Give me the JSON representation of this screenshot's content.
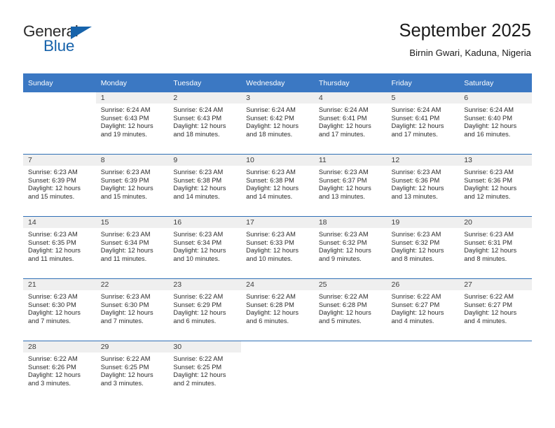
{
  "brand": {
    "name_part1": "General",
    "name_part2": "Blue",
    "accent_color": "#1763ab"
  },
  "header": {
    "title": "September 2025",
    "subtitle": "Birnin Gwari, Kaduna, Nigeria"
  },
  "theme": {
    "header_row_color": "#3b78c3",
    "week_divider_color": "#2f6fb5",
    "daynum_band_color": "#efefef"
  },
  "calendar": {
    "weekday_headers": [
      "Sunday",
      "Monday",
      "Tuesday",
      "Wednesday",
      "Thursday",
      "Friday",
      "Saturday"
    ],
    "weeks": [
      [
        {
          "day": "",
          "blank": true
        },
        {
          "day": "1",
          "sunrise": "Sunrise: 6:24 AM",
          "sunset": "Sunset: 6:43 PM",
          "daylight_line1": "Daylight: 12 hours",
          "daylight_line2": "and 19 minutes."
        },
        {
          "day": "2",
          "sunrise": "Sunrise: 6:24 AM",
          "sunset": "Sunset: 6:43 PM",
          "daylight_line1": "Daylight: 12 hours",
          "daylight_line2": "and 18 minutes."
        },
        {
          "day": "3",
          "sunrise": "Sunrise: 6:24 AM",
          "sunset": "Sunset: 6:42 PM",
          "daylight_line1": "Daylight: 12 hours",
          "daylight_line2": "and 18 minutes."
        },
        {
          "day": "4",
          "sunrise": "Sunrise: 6:24 AM",
          "sunset": "Sunset: 6:41 PM",
          "daylight_line1": "Daylight: 12 hours",
          "daylight_line2": "and 17 minutes."
        },
        {
          "day": "5",
          "sunrise": "Sunrise: 6:24 AM",
          "sunset": "Sunset: 6:41 PM",
          "daylight_line1": "Daylight: 12 hours",
          "daylight_line2": "and 17 minutes."
        },
        {
          "day": "6",
          "sunrise": "Sunrise: 6:24 AM",
          "sunset": "Sunset: 6:40 PM",
          "daylight_line1": "Daylight: 12 hours",
          "daylight_line2": "and 16 minutes."
        }
      ],
      [
        {
          "day": "7",
          "sunrise": "Sunrise: 6:23 AM",
          "sunset": "Sunset: 6:39 PM",
          "daylight_line1": "Daylight: 12 hours",
          "daylight_line2": "and 15 minutes."
        },
        {
          "day": "8",
          "sunrise": "Sunrise: 6:23 AM",
          "sunset": "Sunset: 6:39 PM",
          "daylight_line1": "Daylight: 12 hours",
          "daylight_line2": "and 15 minutes."
        },
        {
          "day": "9",
          "sunrise": "Sunrise: 6:23 AM",
          "sunset": "Sunset: 6:38 PM",
          "daylight_line1": "Daylight: 12 hours",
          "daylight_line2": "and 14 minutes."
        },
        {
          "day": "10",
          "sunrise": "Sunrise: 6:23 AM",
          "sunset": "Sunset: 6:38 PM",
          "daylight_line1": "Daylight: 12 hours",
          "daylight_line2": "and 14 minutes."
        },
        {
          "day": "11",
          "sunrise": "Sunrise: 6:23 AM",
          "sunset": "Sunset: 6:37 PM",
          "daylight_line1": "Daylight: 12 hours",
          "daylight_line2": "and 13 minutes."
        },
        {
          "day": "12",
          "sunrise": "Sunrise: 6:23 AM",
          "sunset": "Sunset: 6:36 PM",
          "daylight_line1": "Daylight: 12 hours",
          "daylight_line2": "and 13 minutes."
        },
        {
          "day": "13",
          "sunrise": "Sunrise: 6:23 AM",
          "sunset": "Sunset: 6:36 PM",
          "daylight_line1": "Daylight: 12 hours",
          "daylight_line2": "and 12 minutes."
        }
      ],
      [
        {
          "day": "14",
          "sunrise": "Sunrise: 6:23 AM",
          "sunset": "Sunset: 6:35 PM",
          "daylight_line1": "Daylight: 12 hours",
          "daylight_line2": "and 11 minutes."
        },
        {
          "day": "15",
          "sunrise": "Sunrise: 6:23 AM",
          "sunset": "Sunset: 6:34 PM",
          "daylight_line1": "Daylight: 12 hours",
          "daylight_line2": "and 11 minutes."
        },
        {
          "day": "16",
          "sunrise": "Sunrise: 6:23 AM",
          "sunset": "Sunset: 6:34 PM",
          "daylight_line1": "Daylight: 12 hours",
          "daylight_line2": "and 10 minutes."
        },
        {
          "day": "17",
          "sunrise": "Sunrise: 6:23 AM",
          "sunset": "Sunset: 6:33 PM",
          "daylight_line1": "Daylight: 12 hours",
          "daylight_line2": "and 10 minutes."
        },
        {
          "day": "18",
          "sunrise": "Sunrise: 6:23 AM",
          "sunset": "Sunset: 6:32 PM",
          "daylight_line1": "Daylight: 12 hours",
          "daylight_line2": "and 9 minutes."
        },
        {
          "day": "19",
          "sunrise": "Sunrise: 6:23 AM",
          "sunset": "Sunset: 6:32 PM",
          "daylight_line1": "Daylight: 12 hours",
          "daylight_line2": "and 8 minutes."
        },
        {
          "day": "20",
          "sunrise": "Sunrise: 6:23 AM",
          "sunset": "Sunset: 6:31 PM",
          "daylight_line1": "Daylight: 12 hours",
          "daylight_line2": "and 8 minutes."
        }
      ],
      [
        {
          "day": "21",
          "sunrise": "Sunrise: 6:23 AM",
          "sunset": "Sunset: 6:30 PM",
          "daylight_line1": "Daylight: 12 hours",
          "daylight_line2": "and 7 minutes."
        },
        {
          "day": "22",
          "sunrise": "Sunrise: 6:23 AM",
          "sunset": "Sunset: 6:30 PM",
          "daylight_line1": "Daylight: 12 hours",
          "daylight_line2": "and 7 minutes."
        },
        {
          "day": "23",
          "sunrise": "Sunrise: 6:22 AM",
          "sunset": "Sunset: 6:29 PM",
          "daylight_line1": "Daylight: 12 hours",
          "daylight_line2": "and 6 minutes."
        },
        {
          "day": "24",
          "sunrise": "Sunrise: 6:22 AM",
          "sunset": "Sunset: 6:28 PM",
          "daylight_line1": "Daylight: 12 hours",
          "daylight_line2": "and 6 minutes."
        },
        {
          "day": "25",
          "sunrise": "Sunrise: 6:22 AM",
          "sunset": "Sunset: 6:28 PM",
          "daylight_line1": "Daylight: 12 hours",
          "daylight_line2": "and 5 minutes."
        },
        {
          "day": "26",
          "sunrise": "Sunrise: 6:22 AM",
          "sunset": "Sunset: 6:27 PM",
          "daylight_line1": "Daylight: 12 hours",
          "daylight_line2": "and 4 minutes."
        },
        {
          "day": "27",
          "sunrise": "Sunrise: 6:22 AM",
          "sunset": "Sunset: 6:27 PM",
          "daylight_line1": "Daylight: 12 hours",
          "daylight_line2": "and 4 minutes."
        }
      ],
      [
        {
          "day": "28",
          "sunrise": "Sunrise: 6:22 AM",
          "sunset": "Sunset: 6:26 PM",
          "daylight_line1": "Daylight: 12 hours",
          "daylight_line2": "and 3 minutes."
        },
        {
          "day": "29",
          "sunrise": "Sunrise: 6:22 AM",
          "sunset": "Sunset: 6:25 PM",
          "daylight_line1": "Daylight: 12 hours",
          "daylight_line2": "and 3 minutes."
        },
        {
          "day": "30",
          "sunrise": "Sunrise: 6:22 AM",
          "sunset": "Sunset: 6:25 PM",
          "daylight_line1": "Daylight: 12 hours",
          "daylight_line2": "and 2 minutes."
        },
        {
          "day": "",
          "blank": true
        },
        {
          "day": "",
          "blank": true
        },
        {
          "day": "",
          "blank": true
        },
        {
          "day": "",
          "blank": true
        }
      ]
    ]
  }
}
